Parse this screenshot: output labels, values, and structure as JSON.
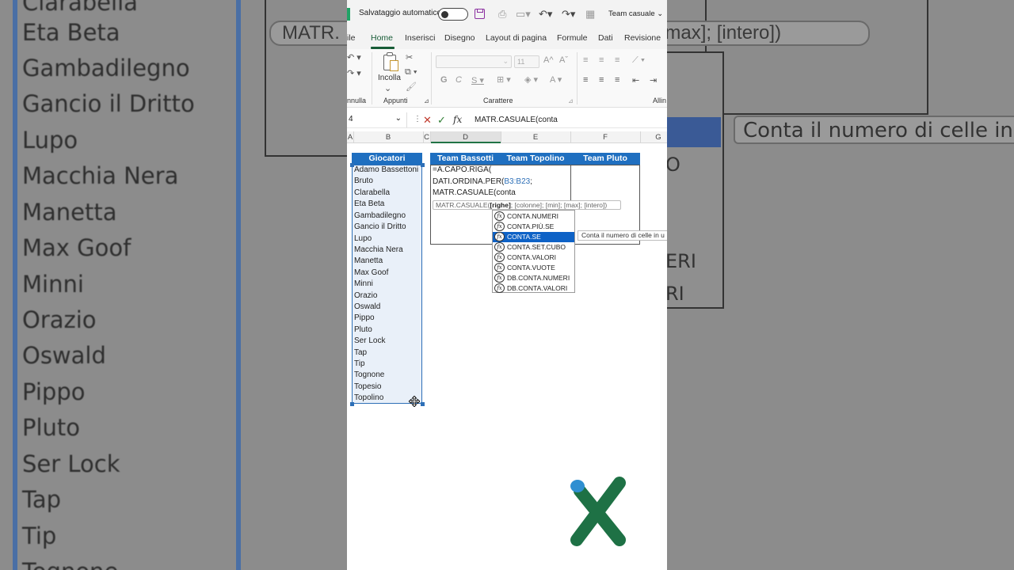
{
  "background_left": {
    "names": [
      "Clarabella",
      "Eta Beta",
      "Gambadilegno",
      "Gancio il Dritto",
      "Lupo",
      "Macchia Nera",
      "Manetta",
      "Max Goof",
      "Minni",
      "Orazio",
      "Oswald",
      "Pippo",
      "Pluto",
      "Ser Lock",
      "Tap",
      "Tip",
      "Tognone"
    ],
    "top_pill": "MATR."
  },
  "background_right": {
    "pill_top": "in]; [max]; [intero])",
    "pill_tip": "Conta il numero di celle in u",
    "frag1": "O",
    "frag2": "ERI",
    "frag3": "RI"
  },
  "titlebar": {
    "autosave_label": "Salvataggio automatico",
    "workbook_name": "Team casuale"
  },
  "tabs": [
    "ile",
    "Home",
    "Inserisci",
    "Disegno",
    "Layout di pagina",
    "Formule",
    "Dati",
    "Revisione"
  ],
  "ribbon": {
    "paste_label": "Incolla",
    "group_labels": [
      "nnulla",
      "Appunti",
      "Carattere",
      "Allin"
    ],
    "font_size": "11"
  },
  "formula_bar": {
    "namebox": "4",
    "formula": "MATR.CASUALE(conta"
  },
  "columns": [
    "A",
    "B",
    "C",
    "D",
    "E",
    "F",
    "G"
  ],
  "sheet": {
    "players_header": "Giocatori",
    "players": [
      "Adamo Bassettoni",
      "Bruto",
      "Clarabella",
      "Eta Beta",
      "Gambadilegno",
      "Gancio il Dritto",
      "Lupo",
      "Macchia Nera",
      "Manetta",
      "Max Goof",
      "Minni",
      "Orazio",
      "Oswald",
      "Pippo",
      "Pluto",
      "Ser Lock",
      "Tap",
      "Tip",
      "Tognone",
      "Topesio",
      "Topolino"
    ],
    "team_headers": [
      "Team Bassotti",
      "Team Topolino",
      "Team Pluto"
    ],
    "formula_lines": {
      "line1": "=A.CAPO.RIGA(",
      "line2_prefix": "DATI.ORDINA.PER(",
      "line2_ref": "B3:B23",
      "line2_suffix": ";",
      "line3": "MATR.CASUALE(conta"
    },
    "signature_prefix": "MATR.CASUALE(",
    "signature_bold": "[righe]",
    "signature_rest": "; [colonne]; [min]; [max]; [intero])"
  },
  "autocomplete": {
    "items": [
      "CONTA.NUMERI",
      "CONTA.PIÙ.SE",
      "CONTA.SE",
      "CONTA.SET.CUBO",
      "CONTA.VALORI",
      "CONTA.VUOTE",
      "DB.CONTA.NUMERI",
      "DB.CONTA.VALORI"
    ],
    "selected_index": 2,
    "tip": "Conta il numero di celle in u"
  },
  "colors": {
    "header_blue": "#1f6fc0",
    "selection_blue": "#0e62c6",
    "excel_green": "#185c37",
    "logo_green": "#1e7145",
    "logo_blue": "#2f8fd1"
  }
}
